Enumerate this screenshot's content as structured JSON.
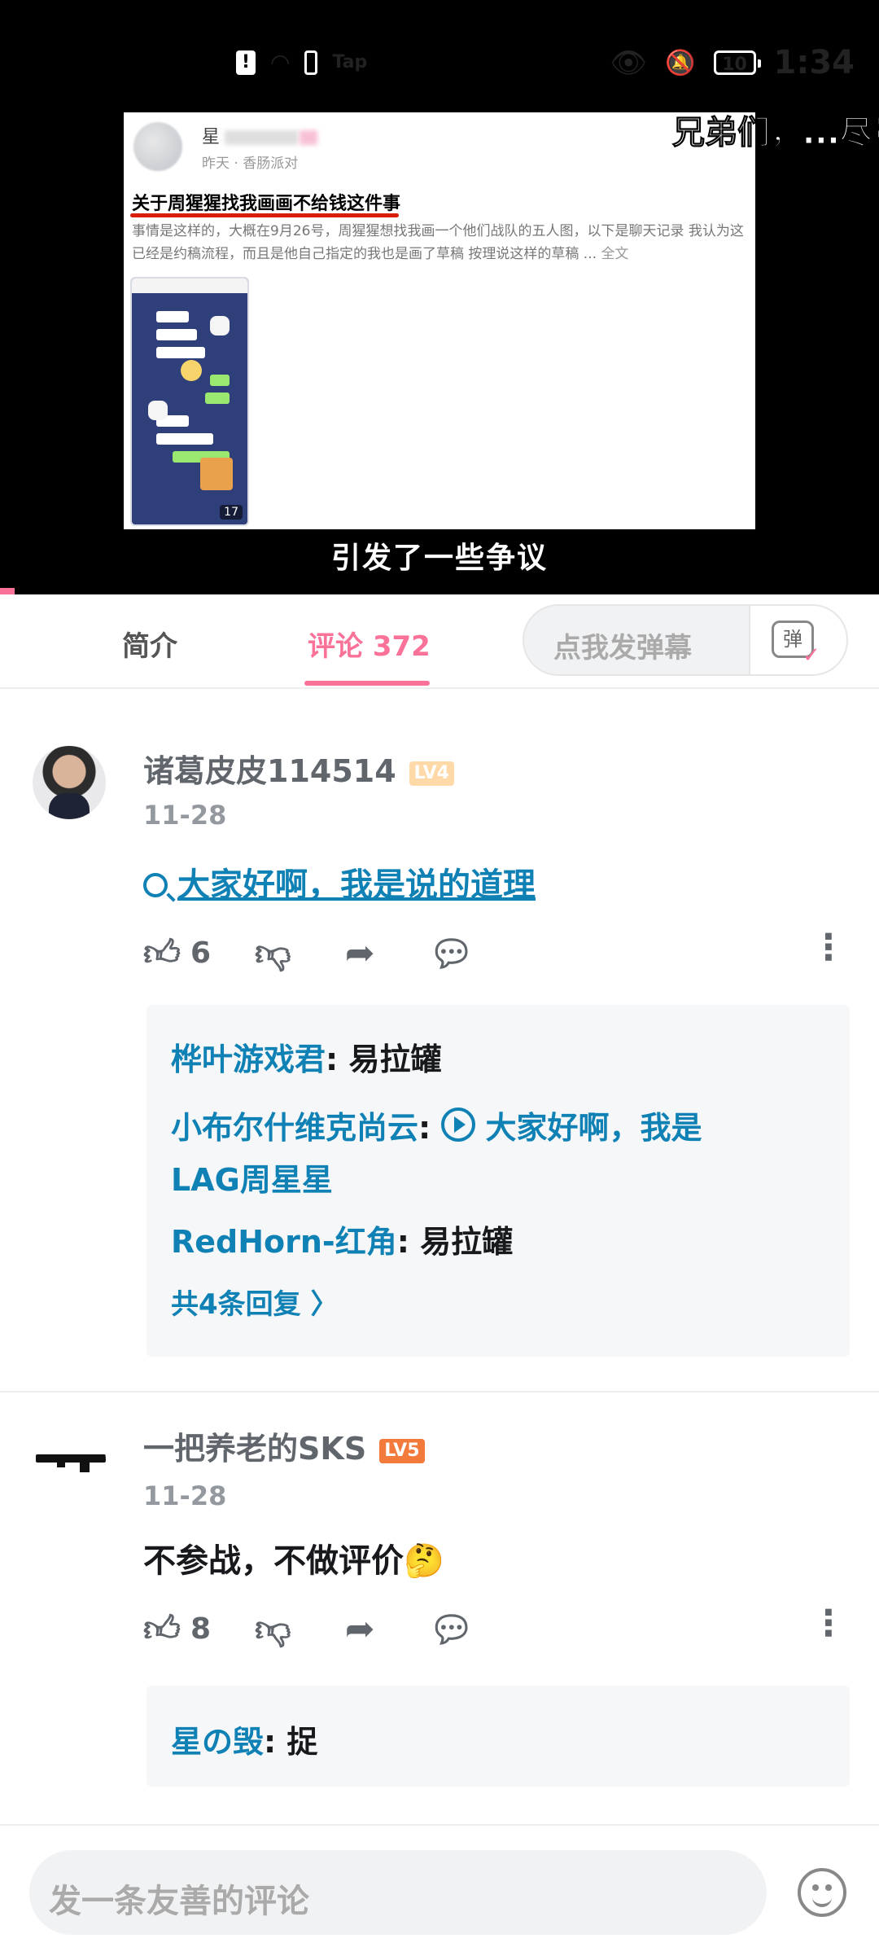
{
  "status_bar": {
    "time": "1:34",
    "battery": "10",
    "tap_label": "Tap"
  },
  "video": {
    "danmaku": "兄弟们，...尽量",
    "subtitle": "引发了一些争议",
    "post": {
      "meta": "昨天 · 香肠派对",
      "title": "关于周猩猩找我画画不给钱这件事",
      "body": "事情是这样的，大概在9月26号，周猩猩想找我画一个他们战队的五人图，以下是聊天记录 我认为这已经是约稿流程，而且是他自己指定的我也是画了草稿 按理说这样的草稿 ...",
      "more": "全文",
      "image_count": "17"
    }
  },
  "tabs": {
    "intro": "简介",
    "comments": "评论",
    "comment_count": "372",
    "danmaku_placeholder": "点我发弹幕",
    "danmaku_button": "弹"
  },
  "comments": [
    {
      "username": "诸葛皮皮114514",
      "level": "LV4",
      "date": "11-28",
      "text": "大家好啊，我是说的道理",
      "likes": "6",
      "replies": [
        {
          "user": "桦叶游戏君",
          "text": "易拉罐"
        },
        {
          "user": "小布尔什维克尚云",
          "text": "大家好啊，我是",
          "text2": "LAG周星星"
        },
        {
          "user": "RedHorn-红角",
          "text": "易拉罐"
        }
      ],
      "total_replies": "共4条回复"
    },
    {
      "username": "一把养老的SKS",
      "level": "LV5",
      "date": "11-28",
      "text": "不参战，不做评价🤔",
      "likes": "8",
      "replies": [
        {
          "user": "星の毁",
          "text": "捉"
        }
      ]
    }
  ],
  "bottom": {
    "placeholder": "发一条友善的评论"
  }
}
